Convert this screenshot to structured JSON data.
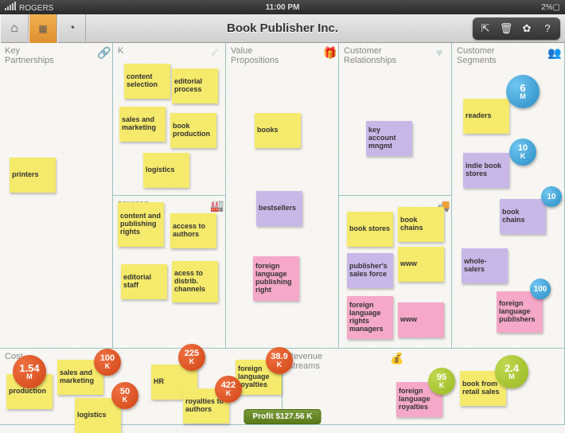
{
  "status": {
    "carrier": "ROGERS",
    "time": "11:00 PM",
    "battery": "2%"
  },
  "title": "Book Publisher Inc.",
  "sections": {
    "kp": "Key Partnerships",
    "ka": "K",
    "vp": "Value Propositions",
    "cr": "Customer Relationships",
    "cs": "Customer Segments",
    "kr": "sources",
    "ch": "",
    "cost": "Cost",
    "rev": "Revenue Streams"
  },
  "notes": {
    "printers": "printers",
    "content_sel": "content selection",
    "editorial_proc": "editorial process",
    "sales_mkt": "sales and marketing",
    "book_prod": "book production",
    "logistics": "logistics",
    "cpr": "content and publishing rights",
    "access_auth": "access to authors",
    "ed_staff": "editorial staff",
    "access_dist": "acess to distrib. channels",
    "books": "books",
    "bestsellers": "bestsellers",
    "flpr": "foreign language publishing right",
    "kam": "key account mngmt",
    "book_stores": "book stores",
    "book_chains": "book chains",
    "www": "www",
    "psf": "publisher's sales force",
    "flrm": "foreign language rights managers",
    "www2": "www",
    "readers": "readers",
    "indie": "indie book stores",
    "book_chains2": "book chains",
    "whole": "whole-salers",
    "flp": "foreign language publishers",
    "production": "production",
    "sales_mkt2": "sales and marketing",
    "logistics2": "logistics",
    "hr": "HR",
    "roy_auth": "royalties to authors",
    "flr": "foreign language royalties",
    "flr2": "foreign language royalties",
    "retail": "book from retail sales"
  },
  "badges": {
    "b6m": {
      "v": "6",
      "u": "M"
    },
    "b10k": {
      "v": "10",
      "u": "K"
    },
    "b10": {
      "v": "10",
      "u": ""
    },
    "b100b": {
      "v": "100",
      "u": ""
    },
    "o154": {
      "v": "1.54",
      "u": "M"
    },
    "o100": {
      "v": "100",
      "u": "K"
    },
    "o50": {
      "v": "50",
      "u": "K"
    },
    "o225": {
      "v": "225",
      "u": "K"
    },
    "o422": {
      "v": "422",
      "u": "K"
    },
    "o389": {
      "v": "38.9",
      "u": "K"
    },
    "g95": {
      "v": "95",
      "u": "K"
    },
    "g24": {
      "v": "2.4",
      "u": "M"
    }
  },
  "profit": "Profit $127.56 K"
}
